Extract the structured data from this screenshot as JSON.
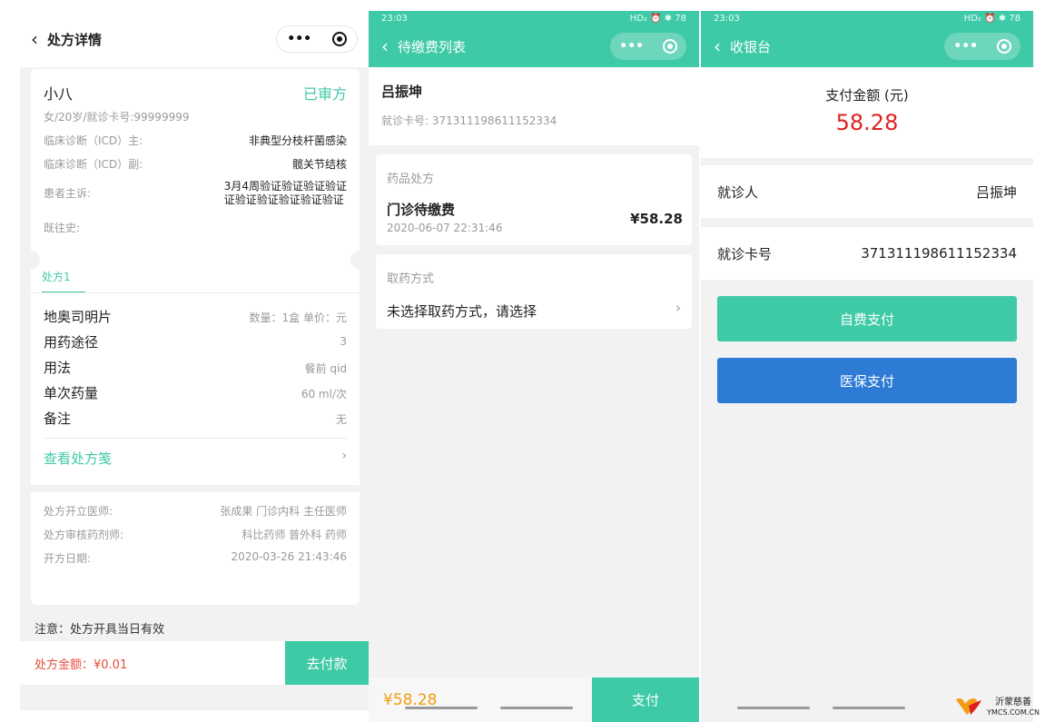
{
  "panel1": {
    "title": "处方详情",
    "patient": {
      "name": "小八",
      "status": "已审方",
      "info": "女/20岁/就诊卡号:99999999",
      "diag_main_label": "临床诊断（ICD）主:",
      "diag_main_value": "非典型分枝杆菌感染",
      "diag_sub_label": "临床诊断（ICD）副:",
      "diag_sub_value": "髋关节结核",
      "complaint_label": "患者主诉:",
      "complaint_value_1": "3月4周验证验证验证验证",
      "complaint_value_2": "证验证验证验证验证验证",
      "history_label": "既往史:"
    },
    "tab": "处方1",
    "drug": {
      "name": "地奥司明片",
      "qty": "数量：1盒 单价：元",
      "route_label": "用药途径",
      "route_value": "3",
      "usage_label": "用法",
      "usage_value": "餐前 qid",
      "dose_label": "单次药量",
      "dose_value": "60 ml/次",
      "remark_label": "备注",
      "remark_value": "无"
    },
    "view_link": "查看处方笺",
    "doctor_label": "处方开立医师:",
    "doctor_value": "张成果 门诊内科 主任医师",
    "pharmacist_label": "处方审核药剂师:",
    "pharmacist_value": "科比药师 普外科 药师",
    "date_label": "开方日期:",
    "date_value": "2020-03-26 21:43:46",
    "note": "注意：处方开具当日有效",
    "amount": "处方金额：¥0.01",
    "pay_button": "去付款"
  },
  "panel2": {
    "status_time": "23:03",
    "status_right": "HD₂ ⏰ ✱ 78",
    "title": "待缴费列表",
    "name": "吕振坤",
    "card": "就诊卡号: 371311198611152334",
    "section_title": "药品处方",
    "item_title": "门诊待缴费",
    "item_time": "2020-06-07 22:31:46",
    "item_amount": "¥58.28",
    "pick_title": "取药方式",
    "pick_value": "未选择取药方式，请选择",
    "bottom_amount": "¥58.28",
    "pay_button": "支付"
  },
  "panel3": {
    "status_time": "23:03",
    "status_right": "HD₂ ⏰ ✱ 78",
    "title": "收银台",
    "amount_label": "支付金额 (元)",
    "amount_value": "58.28",
    "patient_label": "就诊人",
    "patient_value": "吕振坤",
    "card_label": "就诊卡号",
    "card_value": "371311198611152334",
    "self_pay": "自费支付",
    "insurance_pay": "医保支付"
  },
  "logo": {
    "line1": "沂蒙慈善",
    "line2": "YMCS.COM.CN"
  },
  "colors": {
    "accent": "#3ec9a7",
    "blue": "#2e7bd6",
    "red": "#e02020",
    "orange": "#f39c12"
  }
}
